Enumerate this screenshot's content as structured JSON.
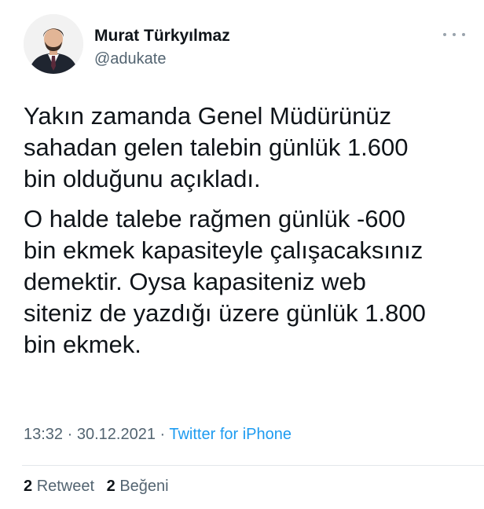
{
  "author": {
    "name": "Murat Türkyılmaz",
    "handle": "@adukate"
  },
  "tweet": {
    "paragraph_1": "Yakın zamanda Genel Müdürünüz\nsahadan gelen talebin günlük 1.600\nbin olduğunu açıkladı.",
    "paragraph_2": "O halde talebe rağmen günlük -600\nbin ekmek kapasiteyle çalışacaksınız\ndemektir. Oysa kapasiteniz web\nsiteniz de yazdığı üzere günlük 1.800\nbin ekmek."
  },
  "meta": {
    "time": "13:32",
    "separator": " · ",
    "date": "30.12.2021",
    "source": "Twitter for iPhone"
  },
  "stats": {
    "retweet_count": "2",
    "retweet_label": "Retweet",
    "like_count": "2",
    "like_label": "Beğeni"
  },
  "colors": {
    "text": "#0f1419",
    "secondary": "#536471",
    "link": "#1d9bf0"
  },
  "icons": {
    "more": "more-options-icon",
    "avatar": "profile-photo"
  }
}
